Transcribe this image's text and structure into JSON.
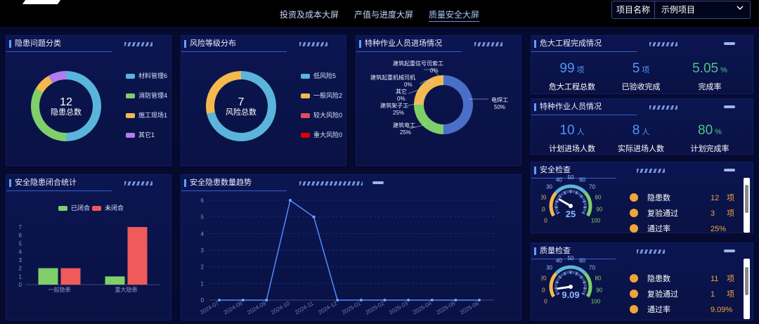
{
  "nav": {
    "items": [
      "投资及成本大屏",
      "产值与进度大屏",
      "质量安全大屏"
    ],
    "active": 2
  },
  "project": {
    "label": "项目名称",
    "value": "示例项目"
  },
  "panels": {
    "hazard_category": {
      "title": "隐患问题分类",
      "center_value": "12",
      "center_label": "隐患总数",
      "legend": [
        {
          "name": "材料管理6",
          "color": "#5ab4dc",
          "value": 6
        },
        {
          "name": "消防管理4",
          "color": "#7fcf6a",
          "value": 4
        },
        {
          "name": "施工现场1",
          "color": "#f3b94e",
          "value": 1
        },
        {
          "name": "其它1",
          "color": "#b07cf0",
          "value": 1
        }
      ]
    },
    "risk_level": {
      "title": "风险等级分布",
      "center_value": "7",
      "center_label": "风险总数",
      "legend": [
        {
          "name": "低风险5",
          "color": "#5ab4dc",
          "value": 5
        },
        {
          "name": "一般风险2",
          "color": "#f3b94e",
          "value": 2
        },
        {
          "name": "较大风险0",
          "color": "#e24c5c",
          "value": 0
        },
        {
          "name": "重大风险0",
          "color": "#e00000",
          "value": 0
        }
      ]
    },
    "special_entry": {
      "title": "特种作业人员进场情况",
      "labels": [
        {
          "name": "建筑起重信号司索工",
          "pct": "0%"
        },
        {
          "name": "建筑起重机械司机",
          "pct": "0%"
        },
        {
          "name": "其它",
          "pct": "0%"
        },
        {
          "name": "建筑架子工",
          "pct": "25%"
        },
        {
          "name": "建筑电工",
          "pct": "25%"
        },
        {
          "name": "电焊工",
          "pct": "50%"
        }
      ],
      "colors": {
        "电焊工": "#4a6fc8",
        "建筑电工": "#7fcf6a",
        "建筑架子工": "#f3b94e"
      }
    },
    "major_projects": {
      "title": "危大工程完成情况",
      "stats": [
        {
          "value": "99",
          "unit": "项",
          "label": "危大工程总数"
        },
        {
          "value": "5",
          "unit": "项",
          "label": "已验收完成"
        },
        {
          "value": "5.05",
          "unit": "%",
          "label": "完成率"
        }
      ]
    },
    "special_personnel": {
      "title": "特种作业人员情况",
      "stats": [
        {
          "value": "10",
          "unit": "人",
          "label": "计划进场人数"
        },
        {
          "value": "8",
          "unit": "人",
          "label": "实际进场人数"
        },
        {
          "value": "80",
          "unit": "%",
          "label": "计划完成率"
        }
      ]
    },
    "closure": {
      "title": "安全隐患闭合统计",
      "legend": [
        {
          "name": "已闭合",
          "color": "#7fcf6a"
        },
        {
          "name": "未闭合",
          "color": "#ef5a5a"
        }
      ]
    },
    "trend": {
      "title": "安全隐患数量趋势"
    },
    "safety_check": {
      "title": "安全检查",
      "gauge_value": "25",
      "gauge_ticks": [
        "0",
        "10",
        "20",
        "30",
        "40",
        "50",
        "60",
        "70",
        "80",
        "90",
        "100"
      ],
      "rows": [
        {
          "label": "隐患数",
          "value": "12",
          "unit": "项"
        },
        {
          "label": "复验通过",
          "value": "3",
          "unit": "项"
        },
        {
          "label": "通过率",
          "value": "25%",
          "unit": ""
        }
      ]
    },
    "quality_check": {
      "title": "质量检查",
      "gauge_value": "9.09",
      "gauge_ticks": [
        "0",
        "10",
        "20",
        "30",
        "40",
        "50",
        "60",
        "70",
        "80",
        "90",
        "100"
      ],
      "rows": [
        {
          "label": "隐患数",
          "value": "11",
          "unit": "项"
        },
        {
          "label": "复验通过",
          "value": "1",
          "unit": "项"
        },
        {
          "label": "通过率",
          "value": "9.09%",
          "unit": ""
        }
      ]
    }
  },
  "chart_data": [
    {
      "type": "bar",
      "title": "安全隐患闭合统计",
      "categories": [
        "一般隐患",
        "重大隐患"
      ],
      "series": [
        {
          "name": "已闭合",
          "values": [
            2,
            1
          ]
        },
        {
          "name": "未闭合",
          "values": [
            2,
            7
          ]
        }
      ],
      "ylim": [
        0,
        7
      ],
      "yticks": [
        "0",
        "1",
        "2",
        "3",
        "4",
        "5",
        "6",
        "7"
      ],
      "grid": false,
      "legend": "top"
    },
    {
      "type": "line",
      "title": "安全隐患数量趋势",
      "x": [
        "2024-07",
        "2024-08",
        "2024-09",
        "2024-10",
        "2024-11",
        "2024-12",
        "2025-01",
        "2025-02",
        "2025-03",
        "2025-04",
        "2025-05",
        "2025-06"
      ],
      "series": [
        {
          "values": [
            0,
            0,
            0,
            6,
            5,
            0,
            0,
            0,
            0,
            0,
            0,
            0
          ]
        }
      ],
      "ylim": [
        0,
        6
      ],
      "yticks": [
        "0",
        "1",
        "2",
        "3",
        "4",
        "5",
        "6"
      ],
      "grid": true
    }
  ]
}
